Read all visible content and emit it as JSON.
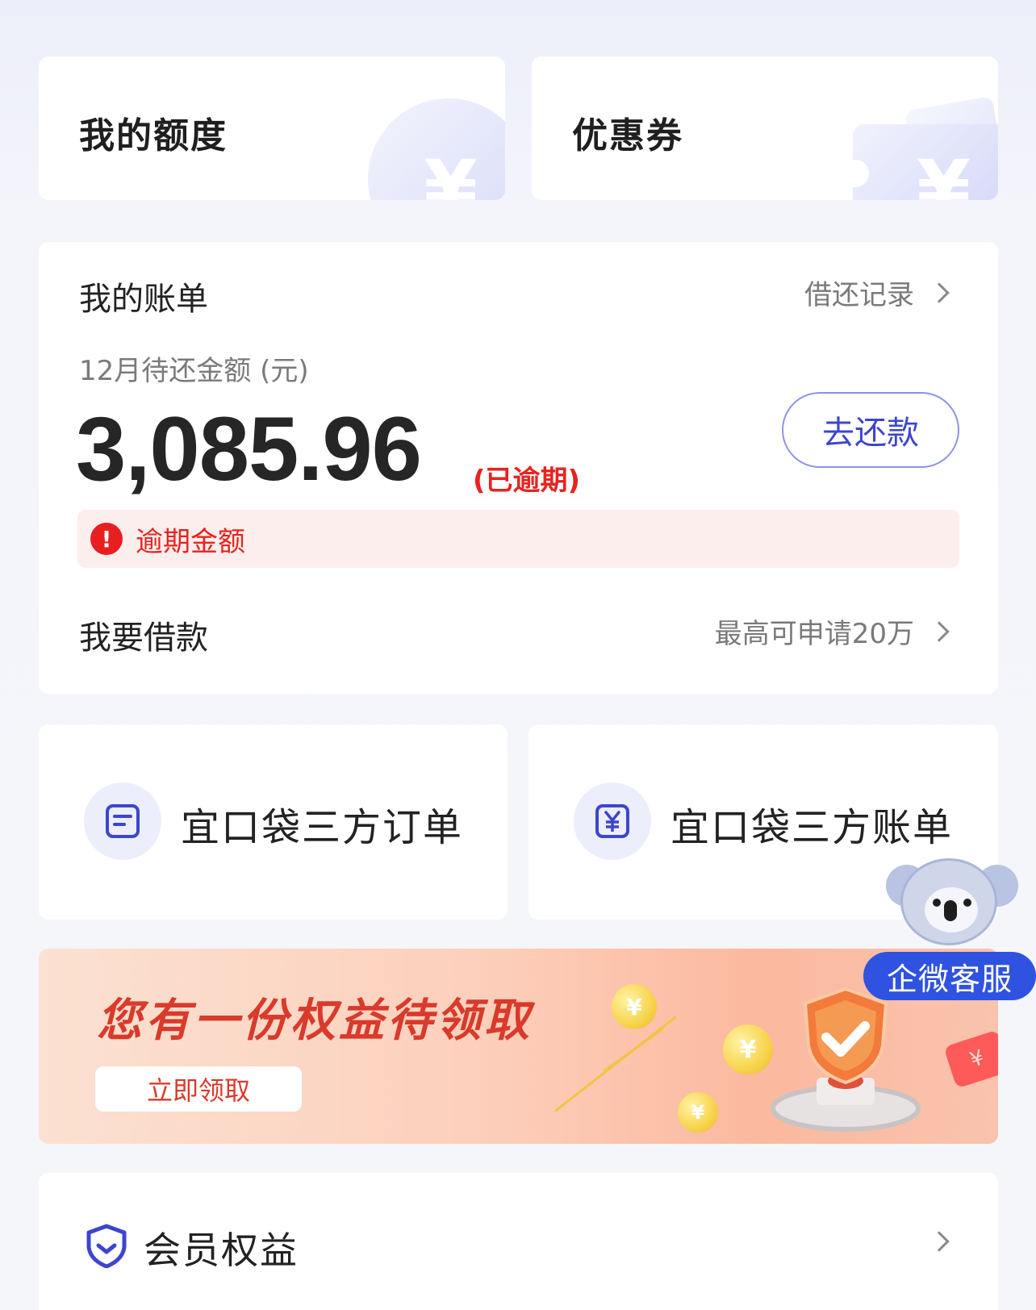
{
  "top_cards": {
    "quota": {
      "title": "我的额度",
      "icon": "yen-circle-icon"
    },
    "coupon": {
      "title": "优惠券",
      "icon": "yen-ticket-icon"
    }
  },
  "bill": {
    "title": "我的账单",
    "history_link": "借还记录",
    "amount_label": "12月待还金额 (元)",
    "amount": "3,085.96",
    "overdue_tag": "(已逾期)",
    "repay_button": "去还款",
    "alert_text": "逾期金额",
    "loan_title": "我要借款",
    "loan_hint": "最高可申请20万"
  },
  "third_party": {
    "orders": {
      "label": "宜口袋三方订单",
      "icon": "document-icon"
    },
    "bills": {
      "label": "宜口袋三方账单",
      "icon": "yen-bill-icon"
    }
  },
  "banner": {
    "title": "您有一份权益待领取",
    "button": "立即领取",
    "coin_symbol": "¥"
  },
  "support": {
    "label": "企微客服",
    "icon": "koala-headset-icon"
  },
  "member": {
    "label": "会员权益",
    "icon": "member-shield-icon"
  },
  "colors": {
    "accent": "#3d45cf",
    "danger": "#e8231f",
    "support_blue": "#2f53e0",
    "banner_red": "#d93a2b"
  }
}
